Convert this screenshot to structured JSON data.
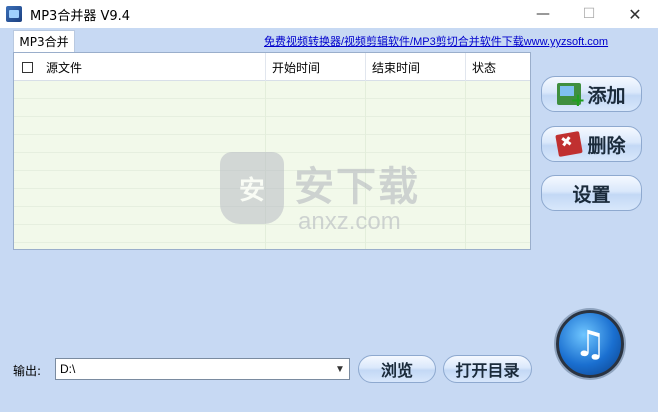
{
  "window": {
    "title": "MP3合并器 V9.4",
    "controls": {
      "minimize": "—",
      "maximize": "☐",
      "close": "✕"
    }
  },
  "tabs": [
    {
      "label": "MP3合并"
    }
  ],
  "promo_link": "免费视频转换器/视频剪辑软件/MP3剪切合并软件下载www.yyzsoft.com",
  "list": {
    "columns": [
      "源文件",
      "开始时间",
      "结束时间",
      "状态"
    ],
    "rows": []
  },
  "watermark": {
    "mark": "安",
    "title": "安下载",
    "subtitle": "anxz.com"
  },
  "side_buttons": {
    "add": "添加",
    "delete": "删除",
    "settings": "设置"
  },
  "output": {
    "label": "输出:",
    "path": "D:\\",
    "browse": "浏览",
    "open_dir": "打开目录"
  },
  "icons": {
    "app": "app-icon",
    "add": "add-file-icon",
    "delete": "delete-file-icon",
    "music": "music-note-icon"
  },
  "colors": {
    "background": "#c7d9f3",
    "list_background": "#f2f9ea",
    "link": "#0000cc"
  }
}
